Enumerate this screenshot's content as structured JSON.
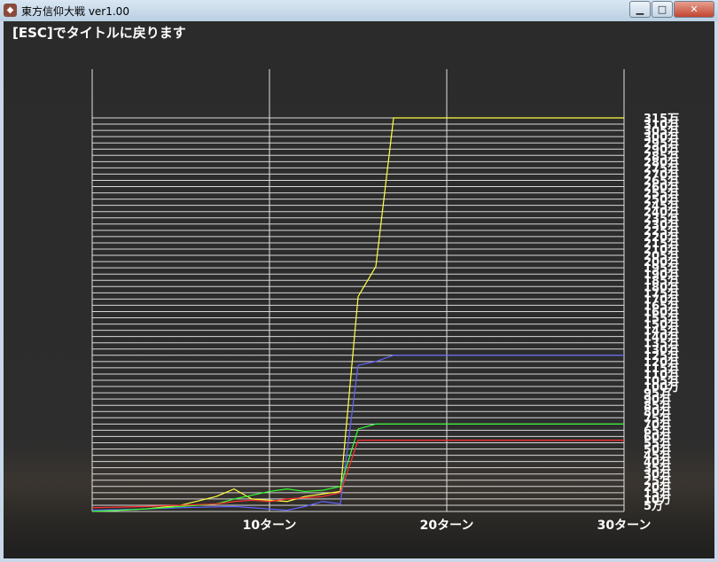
{
  "window": {
    "title": "東方信仰大戦  ver1.00",
    "app_icon": "app-icon",
    "controls": {
      "minimize": "▁",
      "maximize": "□",
      "close": "✕"
    }
  },
  "hint": "[ESC]でタイトルに戻ります",
  "chart_data": {
    "type": "line",
    "xlabel": "",
    "ylabel": "",
    "x_ticks": [
      "10ターン",
      "20ターン",
      "30ターン"
    ],
    "xlim": [
      0,
      30
    ],
    "ylim": [
      0,
      3150000
    ],
    "y_ticks": [
      "5万",
      "10万",
      "15万",
      "20万",
      "25万",
      "30万",
      "35万",
      "40万",
      "45万",
      "50万",
      "55万",
      "60万",
      "65万",
      "70万",
      "75万",
      "80万",
      "85万",
      "90万",
      "95万",
      "100万",
      "105万",
      "110万",
      "115万",
      "120万",
      "125万",
      "130万",
      "135万",
      "140万",
      "145万",
      "150万",
      "155万",
      "160万",
      "165万",
      "170万",
      "175万",
      "180万",
      "185万",
      "190万",
      "195万",
      "200万",
      "205万",
      "210万",
      "215万",
      "220万",
      "225万",
      "230万",
      "235万",
      "240万",
      "245万",
      "250万",
      "255万",
      "260万",
      "265万",
      "270万",
      "275万",
      "280万",
      "285万",
      "290万",
      "295万",
      "300万",
      "305万",
      "310万",
      "315万"
    ],
    "grid": true,
    "series": [
      {
        "color": "#ffff40",
        "x": [
          0,
          3,
          5,
          7,
          8,
          9,
          10,
          11,
          12,
          13,
          14,
          15,
          16,
          17,
          18,
          30
        ],
        "y": [
          0,
          20000,
          50000,
          120000,
          180000,
          100000,
          90000,
          80000,
          120000,
          140000,
          160000,
          1720000,
          1960000,
          3150000,
          3150000,
          3150000
        ]
      },
      {
        "color": "#6060ff",
        "x": [
          0,
          3,
          5,
          8,
          9,
          10,
          11,
          12,
          13,
          14,
          15,
          16,
          17,
          18,
          30
        ],
        "y": [
          10000,
          20000,
          30000,
          40000,
          30000,
          20000,
          10000,
          40000,
          80000,
          60000,
          1170000,
          1200000,
          1250000,
          1250000,
          1250000
        ]
      },
      {
        "color": "#30ff30",
        "x": [
          0,
          3,
          5,
          7,
          8,
          9,
          10,
          11,
          12,
          13,
          14,
          15,
          16,
          17,
          18,
          30
        ],
        "y": [
          0,
          20000,
          40000,
          60000,
          100000,
          130000,
          160000,
          180000,
          160000,
          170000,
          200000,
          660000,
          700000,
          700000,
          700000,
          700000
        ]
      },
      {
        "color": "#ff3030",
        "x": [
          0,
          3,
          5,
          7,
          8,
          9,
          10,
          11,
          12,
          13,
          14,
          15,
          16,
          17,
          18,
          30
        ],
        "y": [
          30000,
          40000,
          50000,
          60000,
          80000,
          90000,
          80000,
          100000,
          110000,
          120000,
          150000,
          570000,
          570000,
          570000,
          570000,
          570000
        ]
      }
    ]
  }
}
